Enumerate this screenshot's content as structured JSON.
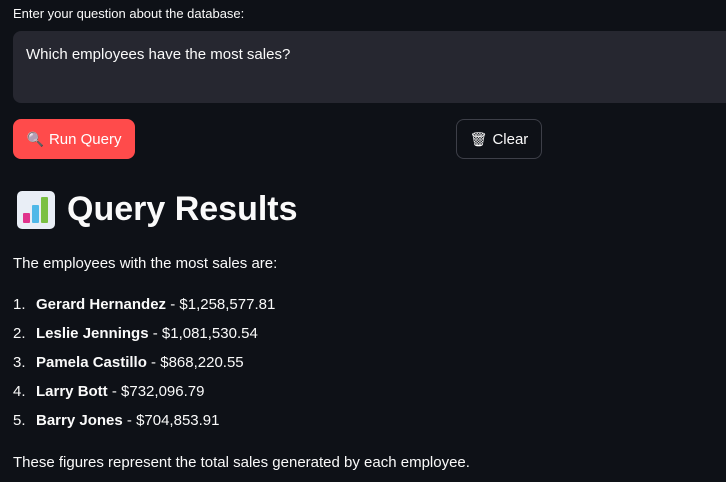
{
  "question": {
    "label": "Enter your question about the database:",
    "value": "Which employees have the most sales?"
  },
  "buttons": {
    "run": {
      "icon": "search-icon",
      "label": "Run Query"
    },
    "clear": {
      "icon": "wastebasket-icon",
      "label": "Clear"
    }
  },
  "results": {
    "icon": "bar-chart-icon",
    "title": "Query Results",
    "intro": "The employees with the most sales are:",
    "items": [
      {
        "num": "1.",
        "name": "Gerard Hernandez",
        "sep": " - ",
        "amount": "$1,258,577.81"
      },
      {
        "num": "2.",
        "name": "Leslie Jennings",
        "sep": " - ",
        "amount": "$1,081,530.54"
      },
      {
        "num": "3.",
        "name": "Pamela Castillo",
        "sep": " - ",
        "amount": "$868,220.55"
      },
      {
        "num": "4.",
        "name": "Larry Bott",
        "sep": " - ",
        "amount": "$732,096.79"
      },
      {
        "num": "5.",
        "name": "Barry Jones",
        "sep": " - ",
        "amount": "$704,853.91"
      }
    ],
    "summary": "These figures represent the total sales generated by each employee."
  },
  "colors": {
    "background": "#0e1117",
    "primary_button": "#ff4b4b",
    "input_background": "#262730",
    "text": "#fafafa"
  }
}
